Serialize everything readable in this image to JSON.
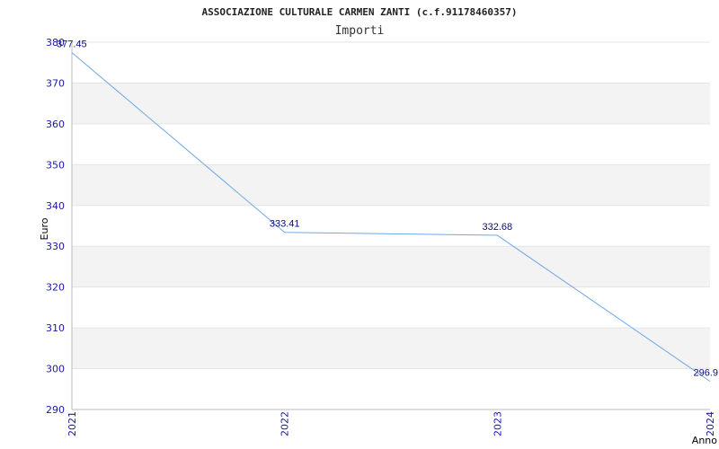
{
  "chart_data": {
    "type": "line",
    "title": "ASSOCIAZIONE CULTURALE CARMEN ZANTI (c.f.91178460357)",
    "subtitle": "Importi",
    "xlabel": "Anno",
    "ylabel": "Euro",
    "categories": [
      "2021",
      "2022",
      "2023",
      "2024"
    ],
    "series": [
      {
        "values": [
          377.45,
          333.41,
          332.68,
          296.9
        ],
        "labels": [
          "377.45",
          "333.41",
          "332.68",
          "296.9"
        ]
      }
    ],
    "ylim": [
      290,
      380
    ],
    "yticks": [
      "290",
      "300",
      "310",
      "320",
      "330",
      "340",
      "350",
      "360",
      "370",
      "380"
    ],
    "grid": "horizontal alternating bands",
    "colors": {
      "line": "#6fa8e6",
      "band": "#f3f3f3",
      "tick_text": "#1a1aa6",
      "data_label": "#0a0a80"
    }
  }
}
